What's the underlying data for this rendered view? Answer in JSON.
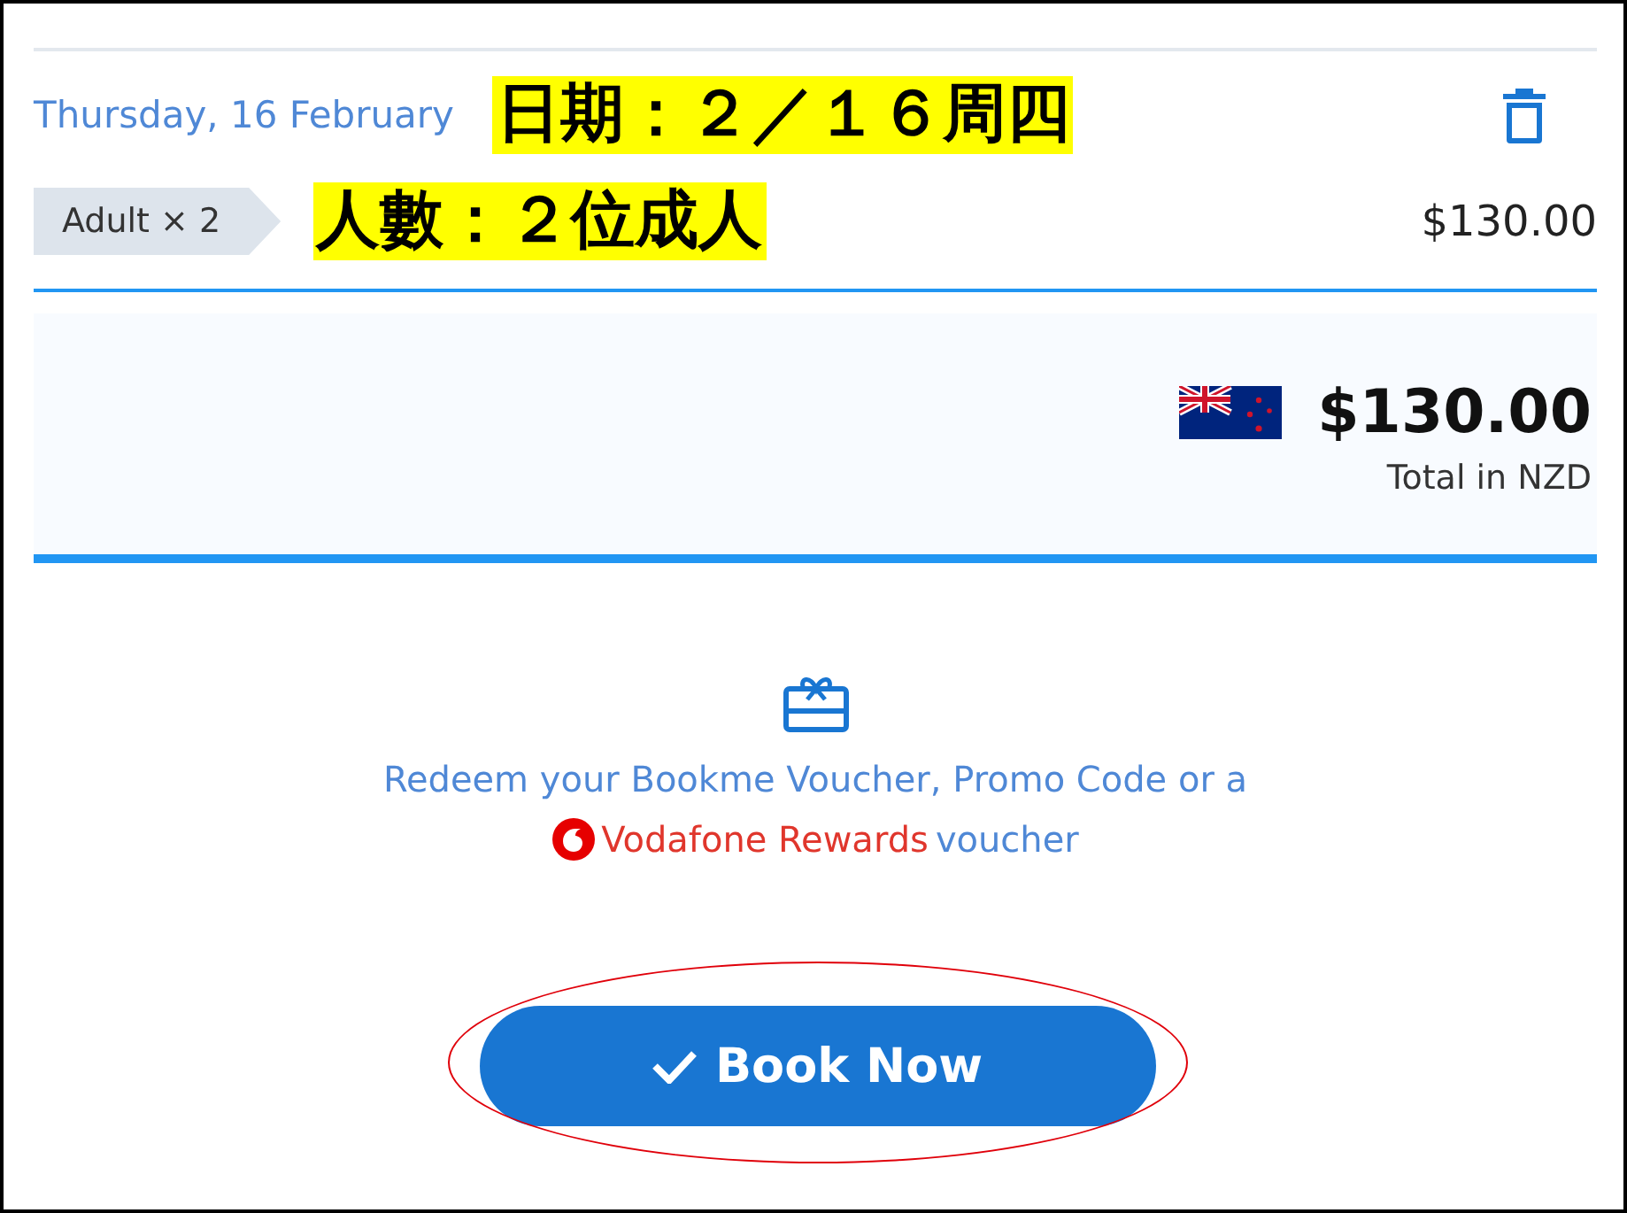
{
  "booking": {
    "date": "Thursday, 16 February",
    "ticket": "Adult × 2",
    "price": "$130.00"
  },
  "annotations": [
    {
      "text": "日期：２／１６周四"
    },
    {
      "text": "人數：２位成人"
    }
  ],
  "total": {
    "amount": "$130.00",
    "caption": "Total in NZD"
  },
  "voucher": {
    "text": "Redeem your Bookme Voucher, Promo Code or a",
    "link": "Vodafone Rewards",
    "suffix": "voucher"
  },
  "book_button": {
    "label": "Book Now",
    "circled": true
  }
}
